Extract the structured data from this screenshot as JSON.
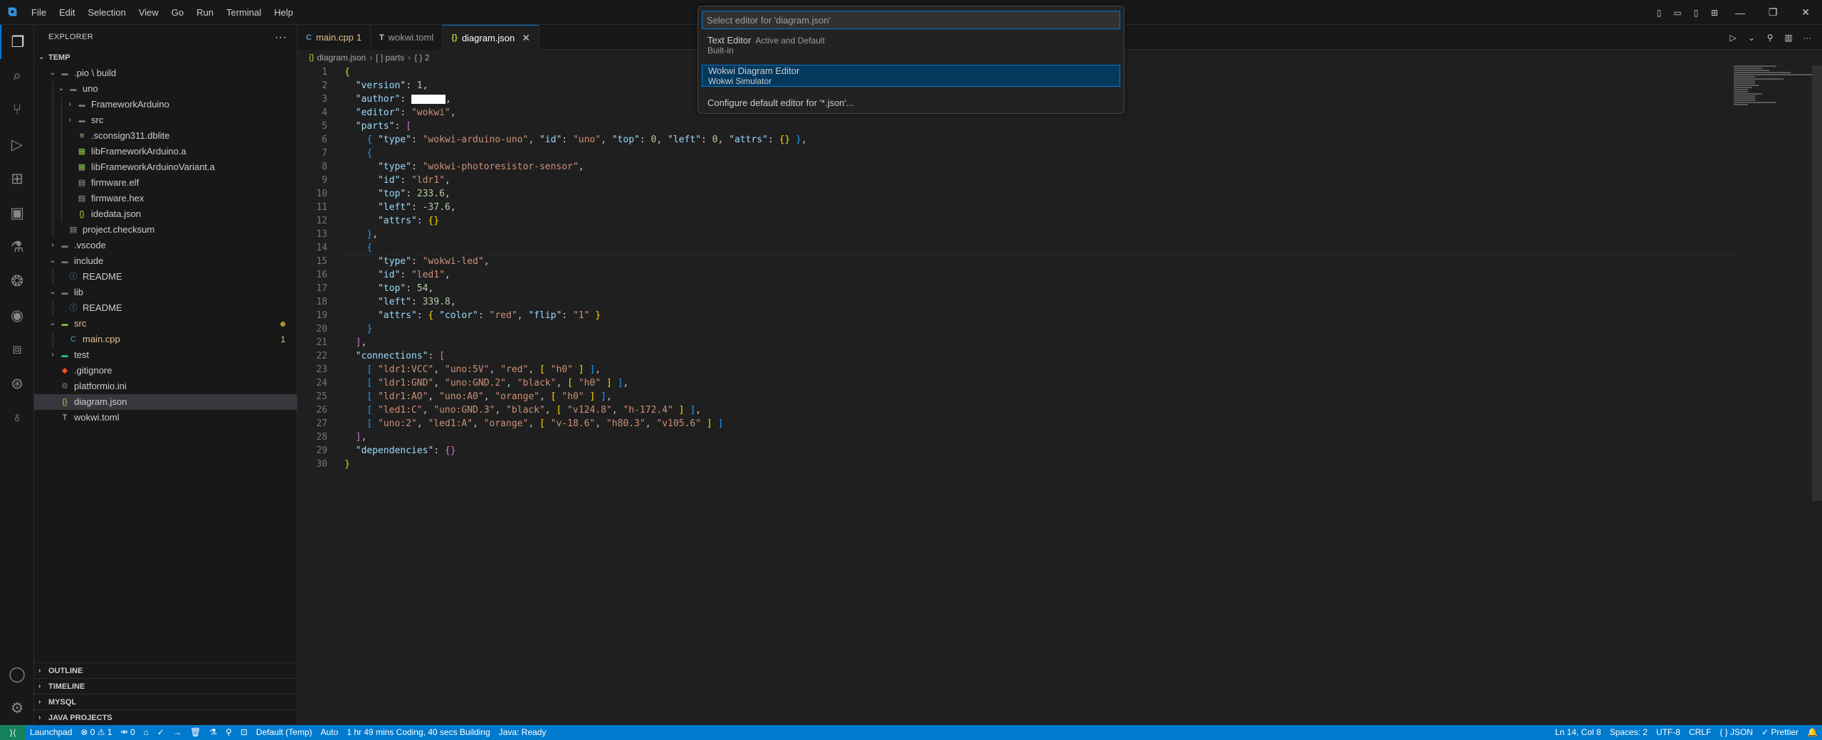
{
  "menu": [
    "File",
    "Edit",
    "Selection",
    "View",
    "Go",
    "Run",
    "Terminal",
    "Help"
  ],
  "explorer": {
    "title": "EXPLORER",
    "root": "TEMP",
    "tree": [
      {
        "label": ".pio \\ build",
        "depth": 1,
        "kind": "folder-open",
        "color": "#cccccc"
      },
      {
        "label": "uno",
        "depth": 2,
        "kind": "folder-open",
        "color": "#cccccc"
      },
      {
        "label": "FrameworkArduino",
        "depth": 3,
        "kind": "folder",
        "color": "#cccccc"
      },
      {
        "label": "src",
        "depth": 3,
        "kind": "folder",
        "color": "#cccccc"
      },
      {
        "label": ".sconsign311.dblite",
        "depth": 3,
        "kind": "file-db",
        "color": "#cccccc"
      },
      {
        "label": "libFrameworkArduino.a",
        "depth": 3,
        "kind": "file-lib",
        "color": "#cccccc"
      },
      {
        "label": "libFrameworkArduinoVariant.a",
        "depth": 3,
        "kind": "file-lib",
        "color": "#cccccc"
      },
      {
        "label": "firmware.elf",
        "depth": 3,
        "kind": "file",
        "color": "#cccccc"
      },
      {
        "label": "firmware.hex",
        "depth": 3,
        "kind": "file",
        "color": "#cccccc"
      },
      {
        "label": "idedata.json",
        "depth": 3,
        "kind": "file-json",
        "color": "#cccccc"
      },
      {
        "label": "project.checksum",
        "depth": 2,
        "kind": "file",
        "color": "#cccccc"
      },
      {
        "label": ".vscode",
        "depth": 1,
        "kind": "folder",
        "color": "#cccccc"
      },
      {
        "label": "include",
        "depth": 1,
        "kind": "folder-open",
        "color": "#cccccc"
      },
      {
        "label": "README",
        "depth": 2,
        "kind": "file-info",
        "color": "#cccccc"
      },
      {
        "label": "lib",
        "depth": 1,
        "kind": "folder-open",
        "color": "#cccccc"
      },
      {
        "label": "README",
        "depth": 2,
        "kind": "file-info",
        "color": "#cccccc"
      },
      {
        "label": "src",
        "depth": 1,
        "kind": "folder-open",
        "color": "#e2c08d",
        "dot": true
      },
      {
        "label": "main.cpp",
        "depth": 2,
        "kind": "file-cpp",
        "color": "#e2c08d",
        "badge": "1"
      },
      {
        "label": "test",
        "depth": 1,
        "kind": "folder",
        "color": "#cccccc"
      },
      {
        "label": ".gitignore",
        "depth": 1,
        "kind": "file-git",
        "color": "#cccccc"
      },
      {
        "label": "platformio.ini",
        "depth": 1,
        "kind": "file-ini",
        "color": "#cccccc"
      },
      {
        "label": "diagram.json",
        "depth": 1,
        "kind": "file-json",
        "color": "#cccccc",
        "selected": true
      },
      {
        "label": "wokwi.toml",
        "depth": 1,
        "kind": "file-toml",
        "color": "#cccccc"
      }
    ],
    "bottom_sections": [
      "OUTLINE",
      "TIMELINE",
      "MYSQL",
      "JAVA PROJECTS"
    ]
  },
  "tabs": [
    {
      "label": "main.cpp",
      "mod": "1",
      "icon": "C",
      "color": "#e2c08d",
      "icon_color": "#519aba"
    },
    {
      "label": "wokwi.toml",
      "mod": "",
      "icon": "T",
      "color": "#9d9d9d",
      "icon_color": "#cccccc"
    },
    {
      "label": "diagram.json",
      "mod": "",
      "icon": "{}",
      "color": "#ffffff",
      "icon_color": "#cbcb41",
      "active": true
    }
  ],
  "breadcrumb": [
    "diagram.json",
    "[ ] parts",
    "{ } 2"
  ],
  "code_lines": [
    [
      [
        "b1",
        "{"
      ]
    ],
    [
      [
        "p",
        "  "
      ],
      [
        "k",
        "\"version\""
      ],
      [
        "p",
        ": "
      ],
      [
        "n",
        "1"
      ],
      [
        "p",
        ","
      ]
    ],
    [
      [
        "p",
        "  "
      ],
      [
        "k",
        "\"author\""
      ],
      [
        "p",
        ": "
      ],
      [
        "r",
        ""
      ],
      [
        "p",
        ","
      ]
    ],
    [
      [
        "p",
        "  "
      ],
      [
        "k",
        "\"editor\""
      ],
      [
        "p",
        ": "
      ],
      [
        "s",
        "\"wokwi\""
      ],
      [
        "p",
        ","
      ]
    ],
    [
      [
        "p",
        "  "
      ],
      [
        "k",
        "\"parts\""
      ],
      [
        "p",
        ": "
      ],
      [
        "b2",
        "["
      ]
    ],
    [
      [
        "p",
        "    "
      ],
      [
        "b3",
        "{"
      ],
      [
        "p",
        " "
      ],
      [
        "k",
        "\"type\""
      ],
      [
        "p",
        ": "
      ],
      [
        "s",
        "\"wokwi-arduino-uno\""
      ],
      [
        "p",
        ", "
      ],
      [
        "k",
        "\"id\""
      ],
      [
        "p",
        ": "
      ],
      [
        "s",
        "\"uno\""
      ],
      [
        "p",
        ", "
      ],
      [
        "k",
        "\"top\""
      ],
      [
        "p",
        ": "
      ],
      [
        "n",
        "0"
      ],
      [
        "p",
        ", "
      ],
      [
        "k",
        "\"left\""
      ],
      [
        "p",
        ": "
      ],
      [
        "n",
        "0"
      ],
      [
        "p",
        ", "
      ],
      [
        "k",
        "\"attrs\""
      ],
      [
        "p",
        ": "
      ],
      [
        "b1",
        "{}"
      ],
      [
        "p",
        " "
      ],
      [
        "b3",
        "}"
      ],
      [
        "p",
        ","
      ]
    ],
    [
      [
        "p",
        "    "
      ],
      [
        "b3",
        "{"
      ]
    ],
    [
      [
        "p",
        "      "
      ],
      [
        "k",
        "\"type\""
      ],
      [
        "p",
        ": "
      ],
      [
        "s",
        "\"wokwi-photoresistor-sensor\""
      ],
      [
        "p",
        ","
      ]
    ],
    [
      [
        "p",
        "      "
      ],
      [
        "k",
        "\"id\""
      ],
      [
        "p",
        ": "
      ],
      [
        "s",
        "\"ldr1\""
      ],
      [
        "p",
        ","
      ]
    ],
    [
      [
        "p",
        "      "
      ],
      [
        "k",
        "\"top\""
      ],
      [
        "p",
        ": "
      ],
      [
        "n",
        "233.6"
      ],
      [
        "p",
        ","
      ]
    ],
    [
      [
        "p",
        "      "
      ],
      [
        "k",
        "\"left\""
      ],
      [
        "p",
        ": "
      ],
      [
        "n",
        "-37.6"
      ],
      [
        "p",
        ","
      ]
    ],
    [
      [
        "p",
        "      "
      ],
      [
        "k",
        "\"attrs\""
      ],
      [
        "p",
        ": "
      ],
      [
        "b1",
        "{}"
      ]
    ],
    [
      [
        "p",
        "    "
      ],
      [
        "b3",
        "}"
      ],
      [
        "p",
        ","
      ]
    ],
    [
      [
        "p",
        "    "
      ],
      [
        "b3",
        "{"
      ]
    ],
    [
      [
        "p",
        "      "
      ],
      [
        "k",
        "\"type\""
      ],
      [
        "p",
        ": "
      ],
      [
        "s",
        "\"wokwi-led\""
      ],
      [
        "p",
        ","
      ]
    ],
    [
      [
        "p",
        "      "
      ],
      [
        "k",
        "\"id\""
      ],
      [
        "p",
        ": "
      ],
      [
        "s",
        "\"led1\""
      ],
      [
        "p",
        ","
      ]
    ],
    [
      [
        "p",
        "      "
      ],
      [
        "k",
        "\"top\""
      ],
      [
        "p",
        ": "
      ],
      [
        "n",
        "54"
      ],
      [
        "p",
        ","
      ]
    ],
    [
      [
        "p",
        "      "
      ],
      [
        "k",
        "\"left\""
      ],
      [
        "p",
        ": "
      ],
      [
        "n",
        "339.8"
      ],
      [
        "p",
        ","
      ]
    ],
    [
      [
        "p",
        "      "
      ],
      [
        "k",
        "\"attrs\""
      ],
      [
        "p",
        ": "
      ],
      [
        "b1",
        "{"
      ],
      [
        "p",
        " "
      ],
      [
        "k",
        "\"color\""
      ],
      [
        "p",
        ": "
      ],
      [
        "s",
        "\"red\""
      ],
      [
        "p",
        ", "
      ],
      [
        "k",
        "\"flip\""
      ],
      [
        "p",
        ": "
      ],
      [
        "s",
        "\"1\""
      ],
      [
        "p",
        " "
      ],
      [
        "b1",
        "}"
      ]
    ],
    [
      [
        "p",
        "    "
      ],
      [
        "b3",
        "}"
      ]
    ],
    [
      [
        "p",
        "  "
      ],
      [
        "b2",
        "]"
      ],
      [
        "p",
        ","
      ]
    ],
    [
      [
        "p",
        "  "
      ],
      [
        "k",
        "\"connections\""
      ],
      [
        "p",
        ": "
      ],
      [
        "b2",
        "["
      ]
    ],
    [
      [
        "p",
        "    "
      ],
      [
        "b3",
        "["
      ],
      [
        "p",
        " "
      ],
      [
        "s",
        "\"ldr1:VCC\""
      ],
      [
        "p",
        ", "
      ],
      [
        "s",
        "\"uno:5V\""
      ],
      [
        "p",
        ", "
      ],
      [
        "s",
        "\"red\""
      ],
      [
        "p",
        ", "
      ],
      [
        "b1",
        "["
      ],
      [
        "p",
        " "
      ],
      [
        "s",
        "\"h0\""
      ],
      [
        "p",
        " "
      ],
      [
        "b1",
        "]"
      ],
      [
        "p",
        " "
      ],
      [
        "b3",
        "]"
      ],
      [
        "p",
        ","
      ]
    ],
    [
      [
        "p",
        "    "
      ],
      [
        "b3",
        "["
      ],
      [
        "p",
        " "
      ],
      [
        "s",
        "\"ldr1:GND\""
      ],
      [
        "p",
        ", "
      ],
      [
        "s",
        "\"uno:GND.2\""
      ],
      [
        "p",
        ", "
      ],
      [
        "s",
        "\"black\""
      ],
      [
        "p",
        ", "
      ],
      [
        "b1",
        "["
      ],
      [
        "p",
        " "
      ],
      [
        "s",
        "\"h0\""
      ],
      [
        "p",
        " "
      ],
      [
        "b1",
        "]"
      ],
      [
        "p",
        " "
      ],
      [
        "b3",
        "]"
      ],
      [
        "p",
        ","
      ]
    ],
    [
      [
        "p",
        "    "
      ],
      [
        "b3",
        "["
      ],
      [
        "p",
        " "
      ],
      [
        "s",
        "\"ldr1:AO\""
      ],
      [
        "p",
        ", "
      ],
      [
        "s",
        "\"uno:A0\""
      ],
      [
        "p",
        ", "
      ],
      [
        "s",
        "\"orange\""
      ],
      [
        "p",
        ", "
      ],
      [
        "b1",
        "["
      ],
      [
        "p",
        " "
      ],
      [
        "s",
        "\"h0\""
      ],
      [
        "p",
        " "
      ],
      [
        "b1",
        "]"
      ],
      [
        "p",
        " "
      ],
      [
        "b3",
        "]"
      ],
      [
        "p",
        ","
      ]
    ],
    [
      [
        "p",
        "    "
      ],
      [
        "b3",
        "["
      ],
      [
        "p",
        " "
      ],
      [
        "s",
        "\"led1:C\""
      ],
      [
        "p",
        ", "
      ],
      [
        "s",
        "\"uno:GND.3\""
      ],
      [
        "p",
        ", "
      ],
      [
        "s",
        "\"black\""
      ],
      [
        "p",
        ", "
      ],
      [
        "b1",
        "["
      ],
      [
        "p",
        " "
      ],
      [
        "s",
        "\"v124.8\""
      ],
      [
        "p",
        ", "
      ],
      [
        "s",
        "\"h-172.4\""
      ],
      [
        "p",
        " "
      ],
      [
        "b1",
        "]"
      ],
      [
        "p",
        " "
      ],
      [
        "b3",
        "]"
      ],
      [
        "p",
        ","
      ]
    ],
    [
      [
        "p",
        "    "
      ],
      [
        "b3",
        "["
      ],
      [
        "p",
        " "
      ],
      [
        "s",
        "\"uno:2\""
      ],
      [
        "p",
        ", "
      ],
      [
        "s",
        "\"led1:A\""
      ],
      [
        "p",
        ", "
      ],
      [
        "s",
        "\"orange\""
      ],
      [
        "p",
        ", "
      ],
      [
        "b1",
        "["
      ],
      [
        "p",
        " "
      ],
      [
        "s",
        "\"v-18.6\""
      ],
      [
        "p",
        ", "
      ],
      [
        "s",
        "\"h80.3\""
      ],
      [
        "p",
        ", "
      ],
      [
        "s",
        "\"v105.6\""
      ],
      [
        "p",
        " "
      ],
      [
        "b1",
        "]"
      ],
      [
        "p",
        " "
      ],
      [
        "b3",
        "]"
      ]
    ],
    [
      [
        "p",
        "  "
      ],
      [
        "b2",
        "]"
      ],
      [
        "p",
        ","
      ]
    ],
    [
      [
        "p",
        "  "
      ],
      [
        "k",
        "\"dependencies\""
      ],
      [
        "p",
        ": "
      ],
      [
        "b2",
        "{}"
      ]
    ],
    [
      [
        "b1",
        "}"
      ]
    ]
  ],
  "quickpick": {
    "placeholder": "Select editor for 'diagram.json'",
    "items": [
      {
        "label": "Text Editor",
        "desc": "Active and Default",
        "detail": "Built-in"
      },
      {
        "label": "Wokwi Diagram Editor",
        "desc": "",
        "detail": "Wokwi Simulator",
        "selected": true
      },
      {
        "label": "Configure default editor for '*.json'...",
        "desc": "",
        "detail": ""
      }
    ]
  },
  "status": {
    "left": [
      "Launchpad",
      "⊗ 0 ⚠ 1",
      "⚮ 0",
      "⌂",
      "✓",
      "→",
      "🗑",
      "⚗",
      "⚲",
      "⊡",
      "Default (Temp)",
      "Auto",
      "1 hr 49 mins Coding, 40 secs Building",
      "Java: Ready"
    ],
    "right": [
      "Ln 14, Col 8",
      "Spaces: 2",
      "UTF-8",
      "CRLF",
      "{ } JSON",
      "✓ Prettier",
      "🔔"
    ]
  },
  "colors": {
    "accent": "#0078d4",
    "statusbar": "#007acc",
    "remote": "#16825d"
  }
}
